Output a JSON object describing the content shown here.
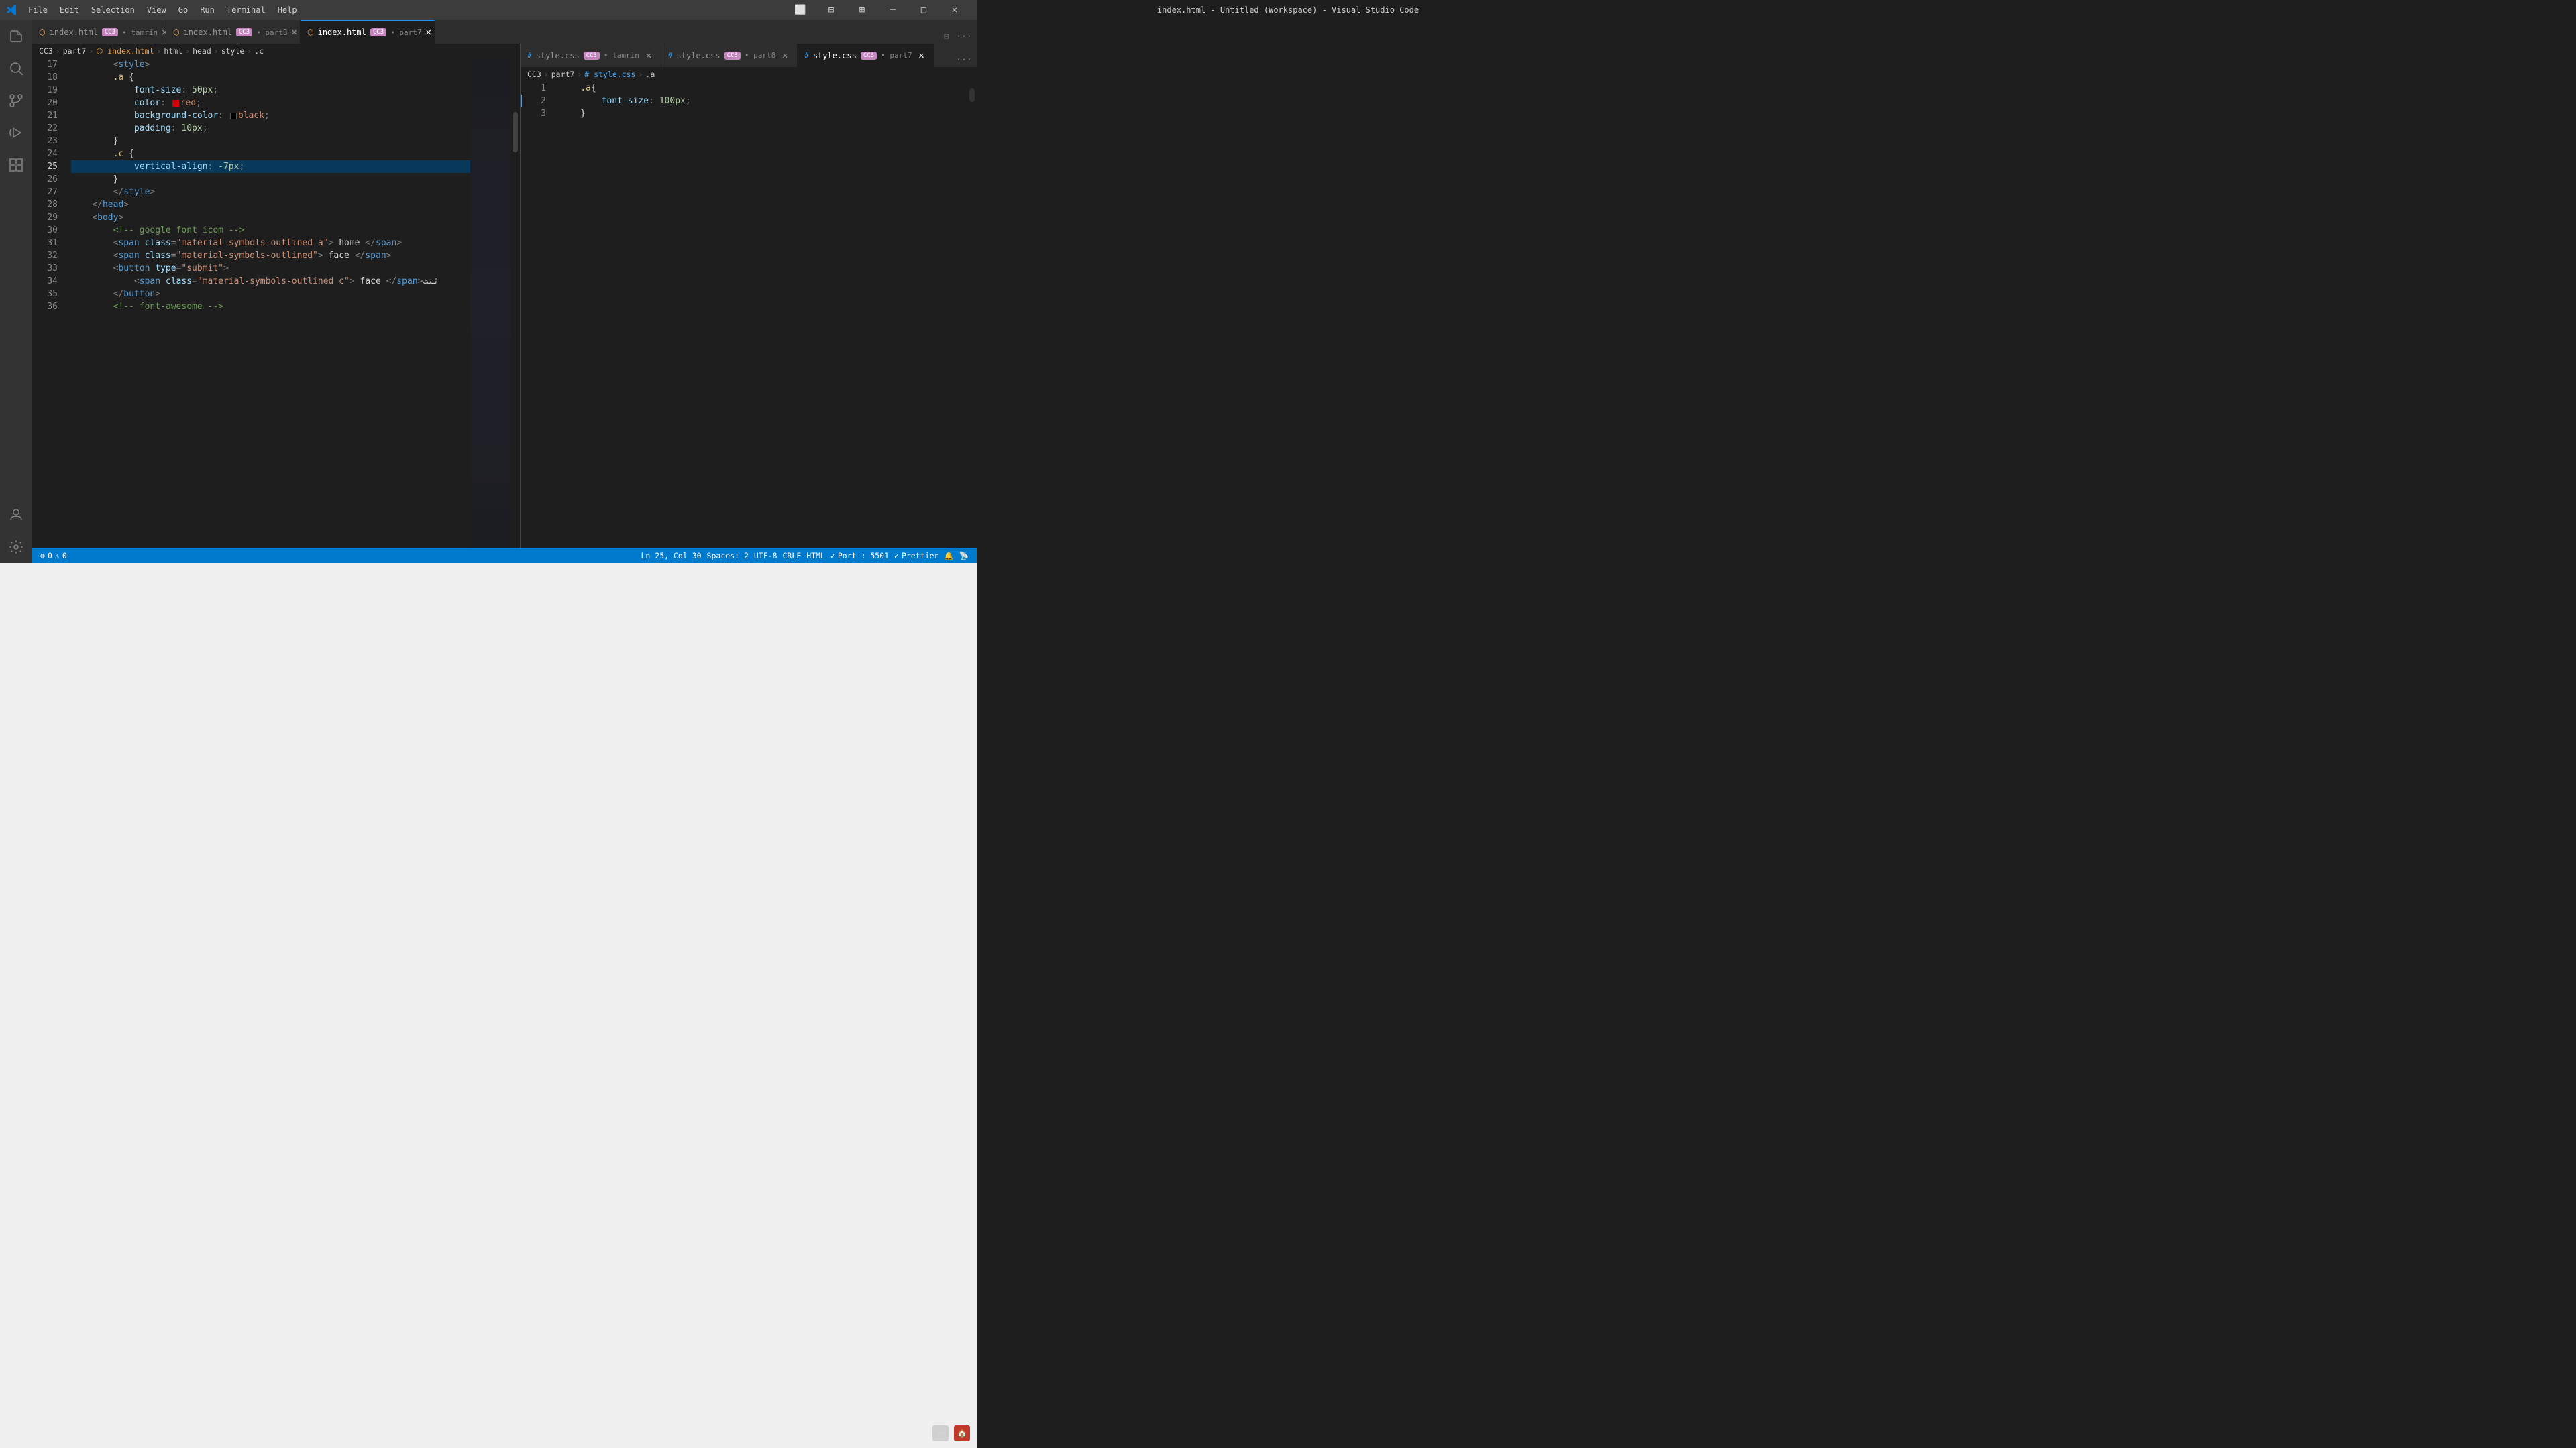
{
  "titleBar": {
    "title": "index.html - Untitled (Workspace) - Visual Studio Code",
    "menus": [
      "File",
      "Edit",
      "Selection",
      "View",
      "Go",
      "Run",
      "Terminal",
      "Help"
    ]
  },
  "tabs": {
    "left": [
      {
        "id": "tab1",
        "filename": "index.html",
        "badge": "CC3",
        "context": "tamrin",
        "active": false,
        "modified": false
      },
      {
        "id": "tab2",
        "filename": "index.html",
        "badge": "CC3",
        "context": "part8",
        "active": false,
        "modified": false
      },
      {
        "id": "tab3",
        "filename": "index.html",
        "badge": "CC3",
        "context": "part7",
        "active": true,
        "modified": false
      }
    ],
    "right": [
      {
        "id": "rtab1",
        "filename": "style.css",
        "badge": "CC3",
        "context": "tamrin",
        "active": false
      },
      {
        "id": "rtab2",
        "filename": "style.css",
        "badge": "CC3",
        "context": "part8",
        "active": false
      },
      {
        "id": "rtab3",
        "filename": "style.css",
        "badge": "CC3",
        "context": "part7",
        "active": true
      }
    ]
  },
  "breadcrumbs": {
    "left": [
      "CC3",
      "part7",
      "index.html",
      "html",
      "head",
      "style",
      ".c"
    ],
    "right": [
      "CC3",
      "part7",
      "style.css",
      ".a"
    ]
  },
  "leftEditor": {
    "lines": [
      {
        "num": 17,
        "content": "        <style>"
      },
      {
        "num": 18,
        "content": "        .a {"
      },
      {
        "num": 19,
        "content": "            font-size: 50px;"
      },
      {
        "num": 20,
        "content": "            color: █red;"
      },
      {
        "num": 21,
        "content": "            background-color: █black;"
      },
      {
        "num": 22,
        "content": "            padding: 10px;"
      },
      {
        "num": 23,
        "content": "        }"
      },
      {
        "num": 24,
        "content": "        .c {"
      },
      {
        "num": 25,
        "content": "            vertical-align: -7px;"
      },
      {
        "num": 26,
        "content": "        }"
      },
      {
        "num": 27,
        "content": "        </style>"
      },
      {
        "num": 28,
        "content": "    </head>"
      },
      {
        "num": 29,
        "content": "    <body>"
      },
      {
        "num": 30,
        "content": "        <!-- google font icom -->"
      },
      {
        "num": 31,
        "content": "        <span class=\"material-symbols-outlined a\"> home </span>"
      },
      {
        "num": 32,
        "content": "        <span class=\"material-symbols-outlined\"> face </span>"
      },
      {
        "num": 33,
        "content": "        <button type=\"submit\">"
      },
      {
        "num": 34,
        "content": "            <span class=\"material-symbols-outlined c\"> face </span>ثنت"
      },
      {
        "num": 35,
        "content": "        </button>"
      },
      {
        "num": 36,
        "content": "        <!-- font-awesome -->"
      }
    ]
  },
  "rightEditor": {
    "lines": [
      {
        "num": 1,
        "content": "    .a{"
      },
      {
        "num": 2,
        "content": "        font-size: 100px;"
      },
      {
        "num": 3,
        "content": "    }"
      }
    ]
  },
  "statusBar": {
    "errors": "0",
    "warnings": "0",
    "branch": "",
    "ln": "25",
    "col": "30",
    "spaces": "2",
    "encoding": "UTF-8",
    "lineEnding": "CRLF",
    "language": "HTML",
    "port": "5501",
    "prettier": "Prettier"
  },
  "activityIcons": [
    {
      "name": "explorer-icon",
      "symbol": "⬜",
      "active": false
    },
    {
      "name": "search-icon",
      "symbol": "🔍",
      "active": false
    },
    {
      "name": "source-control-icon",
      "symbol": "⎇",
      "active": false
    },
    {
      "name": "run-icon",
      "symbol": "▶",
      "active": false
    },
    {
      "name": "extensions-icon",
      "symbol": "⊞",
      "active": false
    }
  ]
}
